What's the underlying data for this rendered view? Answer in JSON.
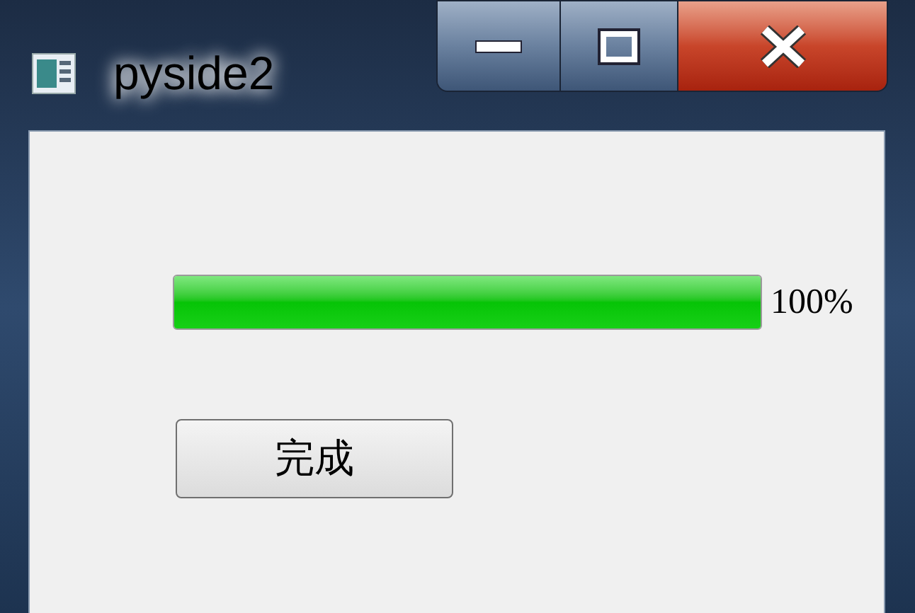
{
  "window": {
    "title": "pyside2"
  },
  "progress": {
    "level": 1,
    "reading": "100%"
  },
  "buttons": [
    {
      "label": "完成"
    }
  ]
}
